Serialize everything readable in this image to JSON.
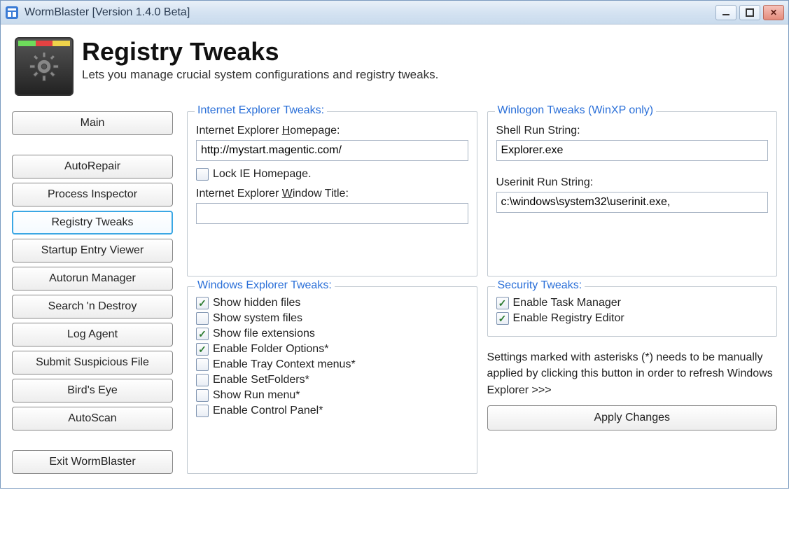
{
  "window": {
    "title": "WormBlaster [Version 1.4.0 Beta]"
  },
  "header": {
    "title": "Registry Tweaks",
    "subtitle": "Lets you manage crucial system configurations and registry tweaks."
  },
  "sidebar": {
    "items": [
      {
        "label": "Main",
        "active": false
      },
      {
        "label": "AutoRepair",
        "active": false
      },
      {
        "label": "Process Inspector",
        "active": false
      },
      {
        "label": "Registry Tweaks",
        "active": true
      },
      {
        "label": "Startup Entry Viewer",
        "active": false
      },
      {
        "label": "Autorun Manager",
        "active": false
      },
      {
        "label": "Search 'n Destroy",
        "active": false
      },
      {
        "label": "Log Agent",
        "active": false
      },
      {
        "label": "Submit Suspicious File",
        "active": false
      },
      {
        "label": "Bird's Eye",
        "active": false
      },
      {
        "label": "AutoScan",
        "active": false
      }
    ],
    "exit_label": "Exit WormBlaster"
  },
  "ie": {
    "legend": "Internet Explorer Tweaks:",
    "homepage_label_pre": "Internet Explorer ",
    "homepage_label_u": "H",
    "homepage_label_post": "omepage:",
    "homepage_value": "http://mystart.magentic.com/",
    "lock_label": "Lock IE Homepage.",
    "lock_checked": false,
    "windowtitle_label_pre": "Internet Explorer ",
    "windowtitle_label_u": "W",
    "windowtitle_label_post": "indow Title:",
    "windowtitle_value": ""
  },
  "winlogon": {
    "legend": "Winlogon Tweaks (WinXP only)",
    "shell_label": "Shell Run String:",
    "shell_value": "Explorer.exe",
    "userinit_label": "Userinit Run String:",
    "userinit_value": "c:\\windows\\system32\\userinit.exe,"
  },
  "explorer": {
    "legend": "Windows Explorer Tweaks:",
    "options": [
      {
        "label": "Show hidden files",
        "checked": true
      },
      {
        "label": "Show system files",
        "checked": false
      },
      {
        "label": "Show file extensions",
        "checked": true
      },
      {
        "label": "Enable Folder Options*",
        "checked": true
      },
      {
        "label": "Enable Tray Context menus*",
        "checked": false
      },
      {
        "label": "Enable SetFolders*",
        "checked": false
      },
      {
        "label": "Show Run menu*",
        "checked": false
      },
      {
        "label": "Enable Control Panel*",
        "checked": false
      }
    ]
  },
  "security": {
    "legend": "Security Tweaks:",
    "options": [
      {
        "label": "Enable Task Manager",
        "checked": true
      },
      {
        "label": "Enable Registry Editor",
        "checked": true
      }
    ]
  },
  "note": "Settings marked with asterisks (*) needs to be manually applied by clicking this button in order to refresh Windows Explorer >>>",
  "apply_label": "Apply Changes"
}
